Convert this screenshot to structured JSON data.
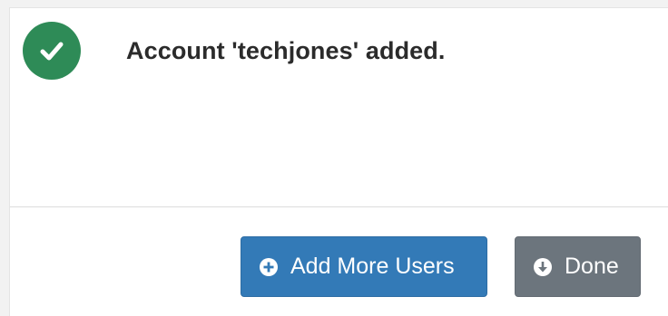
{
  "dialog": {
    "message": "Account 'techjones' added.",
    "status_icon": "check-circle-icon",
    "status_color": "#2e8b57"
  },
  "actions": {
    "add_more_users": {
      "label": "Add More Users",
      "icon": "plus-circle-icon",
      "color": "#337ab7"
    },
    "done": {
      "label": "Done",
      "icon": "arrow-down-circle-icon",
      "color": "#6c757d"
    }
  }
}
